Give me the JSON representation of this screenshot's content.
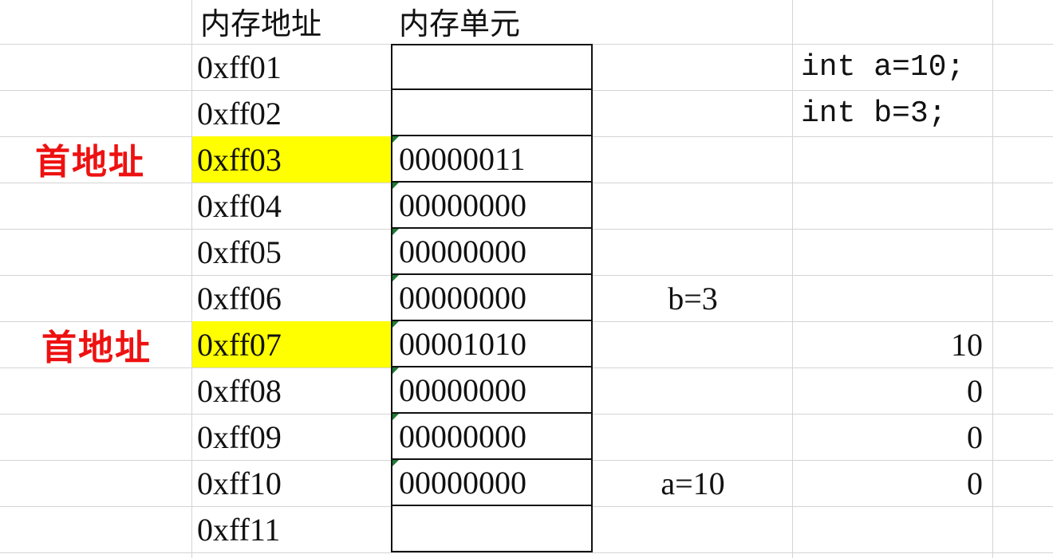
{
  "headers": {
    "address": "内存地址",
    "unit": "内存单元"
  },
  "rows": [
    {
      "address": "0xff01",
      "unit": ""
    },
    {
      "address": "0xff02",
      "unit": ""
    },
    {
      "address": "0xff03",
      "unit": "00000011"
    },
    {
      "address": "0xff04",
      "unit": "00000000"
    },
    {
      "address": "0xff05",
      "unit": "00000000"
    },
    {
      "address": "0xff06",
      "unit": "00000000"
    },
    {
      "address": "0xff07",
      "unit": "00001010"
    },
    {
      "address": "0xff08",
      "unit": "00000000"
    },
    {
      "address": "0xff09",
      "unit": "00000000"
    },
    {
      "address": "0xff10",
      "unit": "00000000"
    },
    {
      "address": "0xff11",
      "unit": ""
    }
  ],
  "annotations": {
    "b_base": "首地址",
    "a_base": "首地址"
  },
  "variables": {
    "b": "b=3",
    "a": "a=10"
  },
  "code": {
    "line1": "int a=10;",
    "line2": "int b=3;"
  },
  "bytes_of_a": [
    "10",
    "0",
    "0",
    "0"
  ],
  "colors": {
    "highlight": "#ffff00",
    "annotation": "#ee1111",
    "border": "#111111",
    "gridline": "#d4d4d4"
  }
}
